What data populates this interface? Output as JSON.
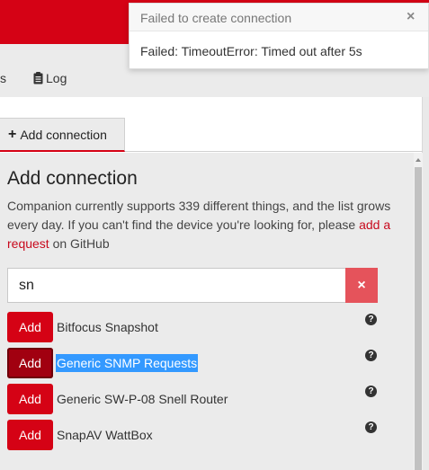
{
  "colors": {
    "brand": "#d50215",
    "clear_button": "#e5535b",
    "link": "#c80a1d",
    "selection": "#3399ff"
  },
  "nav": {
    "items": [
      {
        "label": "s"
      },
      {
        "label": "Log",
        "icon": "clipboard-icon"
      }
    ]
  },
  "tab": {
    "label": "Add connection",
    "icon": "plus-icon"
  },
  "main": {
    "heading": "Add connection",
    "desc_prefix": "Companion currently supports 339 different things, and the list grows every day. If you can't find the device you're looking for, please ",
    "desc_link": "add a request",
    "desc_suffix": " on GitHub"
  },
  "search": {
    "value": "sn",
    "clear_icon": "times-icon"
  },
  "results": [
    {
      "button": "Add",
      "label": "Bitfocus Snapshot",
      "active": false,
      "selected": false
    },
    {
      "button": "Add",
      "label": "Generic SNMP Requests",
      "active": true,
      "selected": true
    },
    {
      "button": "Add",
      "label": "Generic SW-P-08 Snell Router",
      "active": false,
      "selected": false
    },
    {
      "button": "Add",
      "label": "SnapAV WattBox",
      "active": false,
      "selected": false
    }
  ],
  "help_icon": "question-circle-icon",
  "toast": {
    "title": "Failed to create connection",
    "close": "×",
    "body": "Failed: TimeoutError: Timed out after 5s"
  }
}
